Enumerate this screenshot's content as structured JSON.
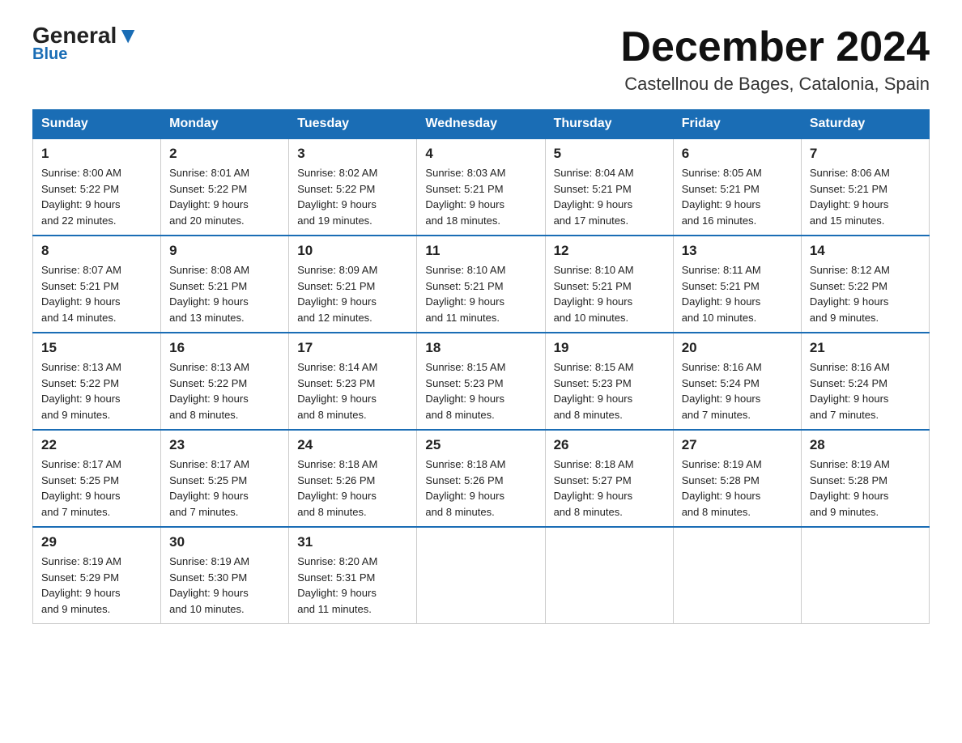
{
  "logo": {
    "part1": "General",
    "part2": "Blue"
  },
  "title": "December 2024",
  "subtitle": "Castellnou de Bages, Catalonia, Spain",
  "days_of_week": [
    "Sunday",
    "Monday",
    "Tuesday",
    "Wednesday",
    "Thursday",
    "Friday",
    "Saturday"
  ],
  "weeks": [
    [
      {
        "num": "1",
        "sunrise": "8:00 AM",
        "sunset": "5:22 PM",
        "daylight": "9 hours and 22 minutes."
      },
      {
        "num": "2",
        "sunrise": "8:01 AM",
        "sunset": "5:22 PM",
        "daylight": "9 hours and 20 minutes."
      },
      {
        "num": "3",
        "sunrise": "8:02 AM",
        "sunset": "5:22 PM",
        "daylight": "9 hours and 19 minutes."
      },
      {
        "num": "4",
        "sunrise": "8:03 AM",
        "sunset": "5:21 PM",
        "daylight": "9 hours and 18 minutes."
      },
      {
        "num": "5",
        "sunrise": "8:04 AM",
        "sunset": "5:21 PM",
        "daylight": "9 hours and 17 minutes."
      },
      {
        "num": "6",
        "sunrise": "8:05 AM",
        "sunset": "5:21 PM",
        "daylight": "9 hours and 16 minutes."
      },
      {
        "num": "7",
        "sunrise": "8:06 AM",
        "sunset": "5:21 PM",
        "daylight": "9 hours and 15 minutes."
      }
    ],
    [
      {
        "num": "8",
        "sunrise": "8:07 AM",
        "sunset": "5:21 PM",
        "daylight": "9 hours and 14 minutes."
      },
      {
        "num": "9",
        "sunrise": "8:08 AM",
        "sunset": "5:21 PM",
        "daylight": "9 hours and 13 minutes."
      },
      {
        "num": "10",
        "sunrise": "8:09 AM",
        "sunset": "5:21 PM",
        "daylight": "9 hours and 12 minutes."
      },
      {
        "num": "11",
        "sunrise": "8:10 AM",
        "sunset": "5:21 PM",
        "daylight": "9 hours and 11 minutes."
      },
      {
        "num": "12",
        "sunrise": "8:10 AM",
        "sunset": "5:21 PM",
        "daylight": "9 hours and 10 minutes."
      },
      {
        "num": "13",
        "sunrise": "8:11 AM",
        "sunset": "5:21 PM",
        "daylight": "9 hours and 10 minutes."
      },
      {
        "num": "14",
        "sunrise": "8:12 AM",
        "sunset": "5:22 PM",
        "daylight": "9 hours and 9 minutes."
      }
    ],
    [
      {
        "num": "15",
        "sunrise": "8:13 AM",
        "sunset": "5:22 PM",
        "daylight": "9 hours and 9 minutes."
      },
      {
        "num": "16",
        "sunrise": "8:13 AM",
        "sunset": "5:22 PM",
        "daylight": "9 hours and 8 minutes."
      },
      {
        "num": "17",
        "sunrise": "8:14 AM",
        "sunset": "5:23 PM",
        "daylight": "9 hours and 8 minutes."
      },
      {
        "num": "18",
        "sunrise": "8:15 AM",
        "sunset": "5:23 PM",
        "daylight": "9 hours and 8 minutes."
      },
      {
        "num": "19",
        "sunrise": "8:15 AM",
        "sunset": "5:23 PM",
        "daylight": "9 hours and 8 minutes."
      },
      {
        "num": "20",
        "sunrise": "8:16 AM",
        "sunset": "5:24 PM",
        "daylight": "9 hours and 7 minutes."
      },
      {
        "num": "21",
        "sunrise": "8:16 AM",
        "sunset": "5:24 PM",
        "daylight": "9 hours and 7 minutes."
      }
    ],
    [
      {
        "num": "22",
        "sunrise": "8:17 AM",
        "sunset": "5:25 PM",
        "daylight": "9 hours and 7 minutes."
      },
      {
        "num": "23",
        "sunrise": "8:17 AM",
        "sunset": "5:25 PM",
        "daylight": "9 hours and 7 minutes."
      },
      {
        "num": "24",
        "sunrise": "8:18 AM",
        "sunset": "5:26 PM",
        "daylight": "9 hours and 8 minutes."
      },
      {
        "num": "25",
        "sunrise": "8:18 AM",
        "sunset": "5:26 PM",
        "daylight": "9 hours and 8 minutes."
      },
      {
        "num": "26",
        "sunrise": "8:18 AM",
        "sunset": "5:27 PM",
        "daylight": "9 hours and 8 minutes."
      },
      {
        "num": "27",
        "sunrise": "8:19 AM",
        "sunset": "5:28 PM",
        "daylight": "9 hours and 8 minutes."
      },
      {
        "num": "28",
        "sunrise": "8:19 AM",
        "sunset": "5:28 PM",
        "daylight": "9 hours and 9 minutes."
      }
    ],
    [
      {
        "num": "29",
        "sunrise": "8:19 AM",
        "sunset": "5:29 PM",
        "daylight": "9 hours and 9 minutes."
      },
      {
        "num": "30",
        "sunrise": "8:19 AM",
        "sunset": "5:30 PM",
        "daylight": "9 hours and 10 minutes."
      },
      {
        "num": "31",
        "sunrise": "8:20 AM",
        "sunset": "5:31 PM",
        "daylight": "9 hours and 11 minutes."
      },
      null,
      null,
      null,
      null
    ]
  ],
  "labels": {
    "sunrise": "Sunrise:",
    "sunset": "Sunset:",
    "daylight": "Daylight:"
  }
}
